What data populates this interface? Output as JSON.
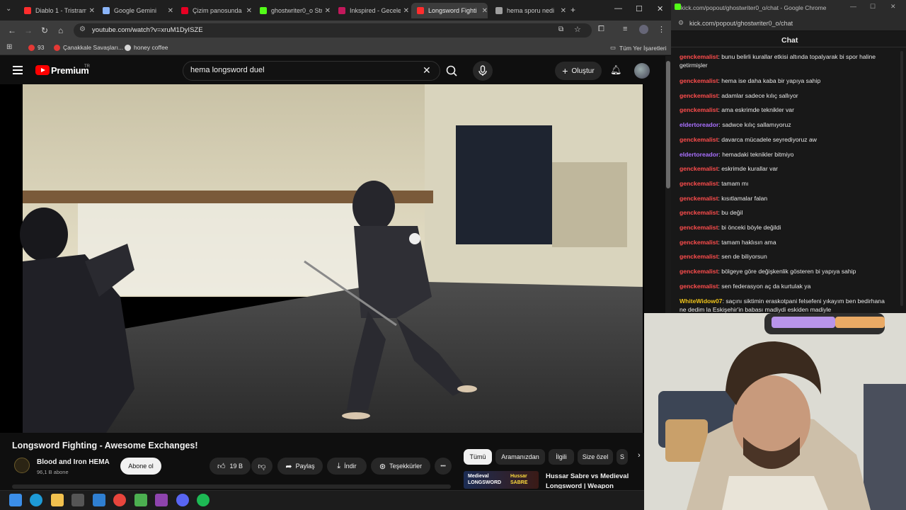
{
  "browser": {
    "tabs": [
      {
        "label": "Diablo 1 - Tristram",
        "favicon_color": "#ff2d2d"
      },
      {
        "label": "Google Gemini",
        "favicon_color": "#8ab4f8"
      },
      {
        "label": "Çizim panosunda",
        "favicon_color": "#e60023"
      },
      {
        "label": "ghostwriter0_o Str",
        "favicon_color": "#53fc18"
      },
      {
        "label": "Inkspired - Gecele",
        "favicon_color": "#c2185b"
      },
      {
        "label": "Longsword Fighti",
        "favicon_color": "#ff2d2d"
      },
      {
        "label": "hema sporu nedi",
        "favicon_color": "#9e9e9e"
      }
    ],
    "url": "youtube.com/watch?v=xruM1DyISZE",
    "bookmarks": [
      {
        "label": "93",
        "color": "#e53935"
      },
      {
        "label": "Çanakkale Savaşları...",
        "color": "#e53935"
      },
      {
        "label": "honey coffee",
        "color": "#d7d7d7"
      }
    ],
    "bookmarks_right": "Tüm Yer İşaretleri"
  },
  "youtube": {
    "brand": "Premium",
    "region": "TR",
    "search_query": "hema longsword duel",
    "create_label": "Oluştur",
    "video": {
      "title": "Longsword Fighting - Awesome Exchanges!",
      "channel": "Blood and Iron HEMA",
      "subscribers": "96,1 B abone",
      "subscribe_label": "Abone ol",
      "likes": "19 B",
      "share_label": "Paylaş",
      "download_label": "İndir",
      "thanks_label": "Teşekkürler",
      "more_label": "•••"
    },
    "chips": [
      "Tümü",
      "Aramanızdan",
      "İlgili",
      "Size özel",
      "S"
    ],
    "recommendation": {
      "title": "Hussar Sabre vs Medieval",
      "title2": "Longsword | Weapon",
      "thumb_left": "Medieval LONGSWORD",
      "thumb_right": "Hussar SABRE"
    }
  },
  "chat_window": {
    "window_title": "kick.com/popout/ghostwriter0_o/chat - Google Chrome",
    "url": "kick.com/popout/ghostwriter0_o/chat",
    "header": "Chat",
    "messages": [
      {
        "user": "genckemalist",
        "color": "#ff4d4d",
        "text": "bunu belirli kurallar etkisi altında topalyarak bi spor haline getirmişler",
        "lines": 2
      },
      {
        "user": "genckemalist",
        "color": "#ff4d4d",
        "text": "hema ise daha kaba bir yapıya sahip",
        "lines": 1
      },
      {
        "user": "genckemalist",
        "color": "#ff4d4d",
        "text": "adamlar sadece kılıç sallıyor",
        "lines": 1
      },
      {
        "user": "genckemalist",
        "color": "#ff4d4d",
        "text": "ama eskrimde teknikler var",
        "lines": 1
      },
      {
        "user": "eldertoreador",
        "color": "#a970ff",
        "text": "sadwce kılıç sallamıyoruz",
        "lines": 1
      },
      {
        "user": "genckemalist",
        "color": "#ff4d4d",
        "text": "davarca mücadele seyrediyoruz aw",
        "lines": 1
      },
      {
        "user": "eldertoreador",
        "color": "#a970ff",
        "text": "hemadaki teknikler bitmiyo",
        "lines": 1
      },
      {
        "user": "genckemalist",
        "color": "#ff4d4d",
        "text": "eskrimde kurallar var",
        "lines": 1
      },
      {
        "user": "genckemalist",
        "color": "#ff4d4d",
        "text": "tamam mı",
        "lines": 1
      },
      {
        "user": "genckemalist",
        "color": "#ff4d4d",
        "text": "kısıtlamalar falan",
        "lines": 1
      },
      {
        "user": "genckemalist",
        "color": "#ff4d4d",
        "text": "bu değil",
        "lines": 1
      },
      {
        "user": "genckemalist",
        "color": "#ff4d4d",
        "text": "bi önceki böyle değildi",
        "lines": 1
      },
      {
        "user": "genckemalist",
        "color": "#ff4d4d",
        "text": "tamam haklısın ama",
        "lines": 1
      },
      {
        "user": "genckemalist",
        "color": "#ff4d4d",
        "text": "sen de biliyorsun",
        "lines": 1
      },
      {
        "user": "genckemalist",
        "color": "#ff4d4d",
        "text": "bölgeye göre değişkenlik gösteren bi yapıya sahip",
        "lines": 1
      },
      {
        "user": "genckemalist",
        "color": "#ff4d4d",
        "text": "sen federasyon aç da kurtulak ya",
        "lines": 1
      },
      {
        "user": "WhiteWidow07",
        "color": "#f0c419",
        "text": "saçını siktimin eraskotpani felsefeni yıkayım ben bedirhana ne dedim la Eskişehir'in babası madiydi eskiden madiyle",
        "lines": 2
      }
    ]
  },
  "taskbar": {
    "apps": [
      {
        "name": "windows",
        "color": "#3b8ee8"
      },
      {
        "name": "edge",
        "color": "#1e9bd7"
      },
      {
        "name": "explorer",
        "color": "#f2c14e"
      },
      {
        "name": "store",
        "color": "#555555"
      },
      {
        "name": "app",
        "color": "#2f7fd1"
      },
      {
        "name": "chrome",
        "color": "#e8453c"
      },
      {
        "name": "minecraft",
        "color": "#4caf50"
      },
      {
        "name": "app2",
        "color": "#8e44ad"
      },
      {
        "name": "discord",
        "color": "#5865f2"
      },
      {
        "name": "spotify",
        "color": "#1db954"
      }
    ]
  }
}
